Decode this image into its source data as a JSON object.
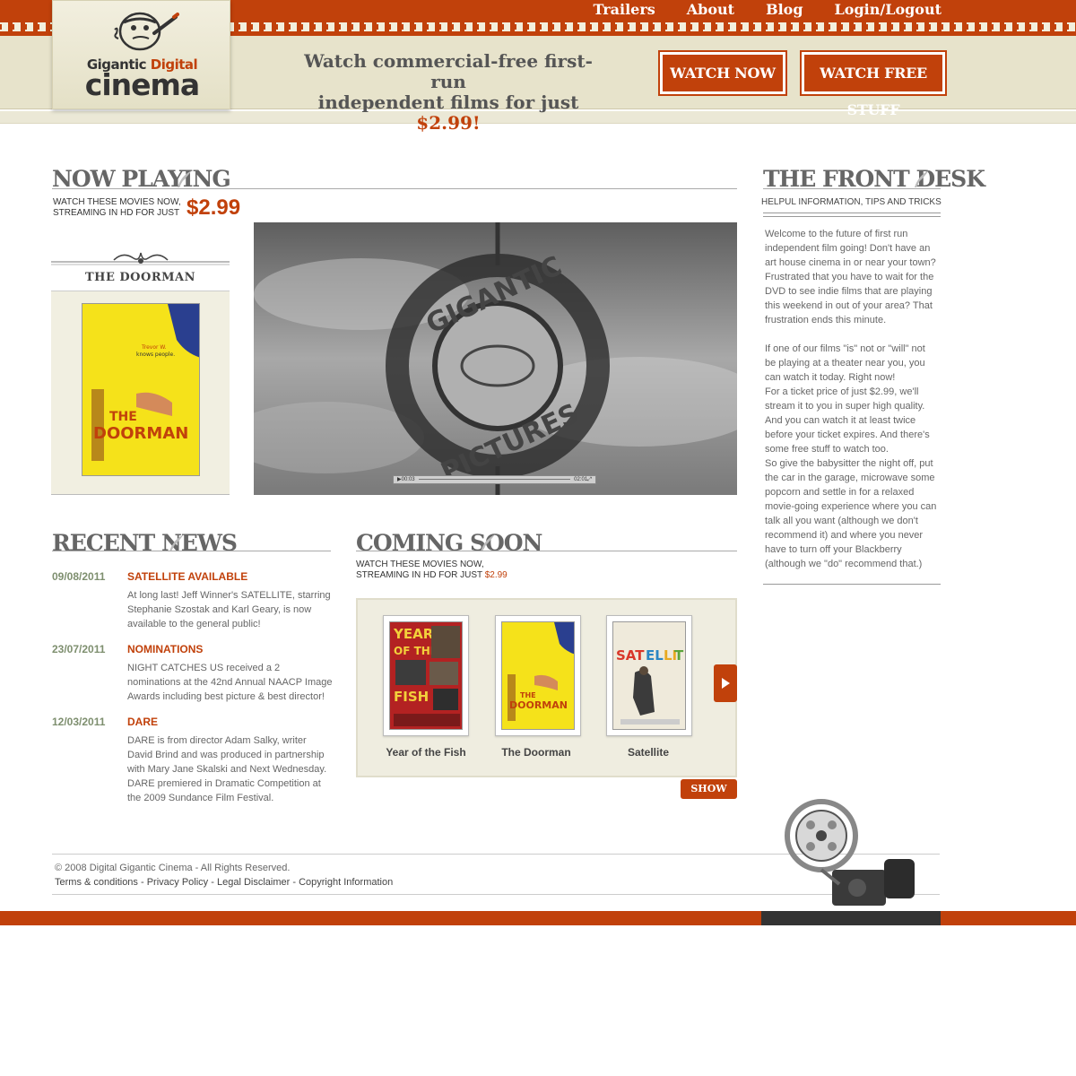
{
  "nav": {
    "items": [
      "Trailers",
      "About",
      "Blog",
      "Login/Logout"
    ]
  },
  "logo": {
    "line1_word1": "Gigantic",
    "line1_word2": "Digital",
    "line2": "cinema"
  },
  "header": {
    "tagline_line1": "Watch commercial-free first-run",
    "tagline_line2": "independent films for just",
    "tagline_price": "$2.99!",
    "watch_now": "WATCH NOW",
    "watch_free": "WATCH FREE STUFF"
  },
  "now_playing": {
    "title": "NOW PLAYING",
    "subtitle_line1": "WATCH THESE MOVIES NOW,",
    "subtitle_line2": "STREAMING IN HD FOR JUST",
    "price": "$2.99",
    "feature_title": "THE DOORMAN",
    "video": {
      "sign_top": "GIGANTIC",
      "sign_bottom": "PICTURES",
      "time_elapsed": "00:03",
      "time_total": "02:01"
    }
  },
  "recent_news": {
    "title": "RECENT NEWS",
    "items": [
      {
        "date": "09/08/2011",
        "title": "SATELLITE AVAILABLE",
        "body": "At long last! Jeff Winner's SATELLITE, starring Stephanie Szostak and Karl Geary, is now available to the general public!"
      },
      {
        "date": "23/07/2011",
        "title": "NOMINATIONS",
        "body": "NIGHT CATCHES US received a 2 nominations at the 42nd Annual NAACP Image Awards including best picture & best director!"
      },
      {
        "date": "12/03/2011",
        "title": "DARE",
        "body": "DARE is from director Adam Salky, writer David Brind and was produced in partnership with Mary Jane Skalski and Next Wednesday. DARE premiered in Dramatic Competition at the 2009 Sundance Film Festival."
      }
    ]
  },
  "coming_soon": {
    "title": "COMING SOON",
    "subtitle_line1": "WATCH THESE MOVIES NOW,",
    "subtitle_line2": "STREAMING IN HD FOR JUST",
    "price": "$2.99",
    "films": [
      {
        "title": "Year of the Fish",
        "poster_text": "YEAR OF THE FISH"
      },
      {
        "title": "The Doorman",
        "poster_text": "THE DOORMAN"
      },
      {
        "title": "Satellite",
        "poster_text": "SATELLITE"
      }
    ],
    "show_all": "SHOW ALL"
  },
  "front_desk": {
    "title": "THE FRONT DESK",
    "subtitle": "HELPUL INFORMATION, TIPS AND TRICKS",
    "body": "Welcome to the future of first run independent film going! Don't have an art house cinema in or near your town? Frustrated that you have to wait for the DVD to see indie films that are playing this weekend in out of your area? That frustration ends this minute.\n\nIf one of our films \"is\" not or \"will\" not be playing at a theater near you, you can watch it today. Right now!\nFor a ticket price of just $2.99, we'll stream it to you in super high quality. And you can watch it at least twice before your ticket expires. And there's some free stuff to watch too.\nSo give the babysitter the night off, put the car in the garage, microwave some popcorn and settle in for a relaxed movie-going experience where you can talk all you want (although we don't recommend it) and where you never have to turn off your Blackberry (although we \"do\" recommend that.)"
  },
  "footer": {
    "copyright": "© 2008 Digital Gigantic Cinema - All Rights Reserved.",
    "links": [
      "Terms & conditions",
      "Privacy Policy",
      "Legal Disclaimer",
      "Copyright Information"
    ],
    "separator": " - "
  },
  "colors": {
    "brand": "#c1410b",
    "cream": "#e7e3cb",
    "date_green": "#7e8f6f"
  }
}
